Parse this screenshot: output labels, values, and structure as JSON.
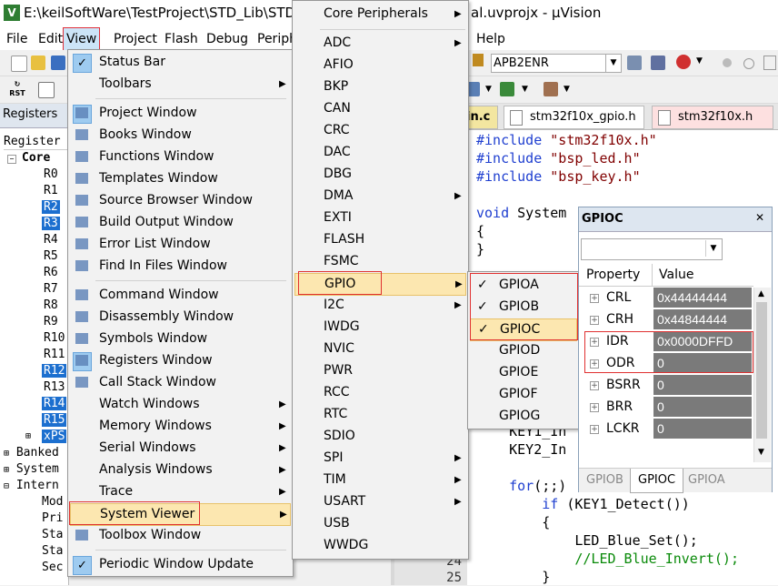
{
  "title_bar": {
    "app_icon": "keil-logo-icon",
    "text": "E:\\keilSoftWare\\TestProject\\STD_Lib\\STD",
    "text_right": "al.uvprojx - µVision"
  },
  "menubar": {
    "items": [
      "File",
      "Edit",
      "View",
      "Project",
      "Flash",
      "Debug",
      "Periph",
      "Help"
    ],
    "selected": "View"
  },
  "toolbar": {
    "target_combo": "APB2ENR"
  },
  "registers_panel": {
    "tab": "Registers",
    "header": "Register",
    "core_label": "Core",
    "rows": [
      "R0",
      "R1",
      "R2",
      "R3",
      "R4",
      "R5",
      "R6",
      "R7",
      "R8",
      "R9",
      "R10",
      "R11",
      "R12",
      "R13",
      "R14",
      "R15",
      "xPS"
    ],
    "highlighted": [
      "R2",
      "R3",
      "R12",
      "R14",
      "R15",
      "xPS"
    ],
    "groups": [
      "Banked",
      "System",
      "Intern"
    ],
    "sub_items": [
      "Mod",
      "Pri",
      "Sta",
      "Sta",
      "Sec"
    ]
  },
  "editor": {
    "tabs": [
      {
        "label": "in.c",
        "color": "#f3e6a0"
      },
      {
        "label": "stm32f10x_gpio.h",
        "color": "#fff"
      },
      {
        "label": "stm32f10x.h",
        "color": "#fde0e0"
      }
    ],
    "lines": [
      {
        "parts": [
          {
            "t": "#include ",
            "c": "kw"
          },
          {
            "t": "\"stm32f10x.h\"",
            "c": "str"
          }
        ]
      },
      {
        "parts": [
          {
            "t": "#include ",
            "c": "kw"
          },
          {
            "t": "\"bsp_led.h\"",
            "c": "str"
          }
        ]
      },
      {
        "parts": [
          {
            "t": "#include ",
            "c": "kw"
          },
          {
            "t": "\"bsp_key.h\"",
            "c": "str"
          }
        ]
      },
      {
        "parts": [
          {
            "t": "",
            "c": ""
          }
        ]
      },
      {
        "parts": [
          {
            "t": "void ",
            "c": "kw"
          },
          {
            "t": "System",
            "c": ""
          }
        ]
      },
      {
        "parts": [
          {
            "t": "{",
            "c": ""
          }
        ]
      },
      {
        "parts": [
          {
            "t": "}",
            "c": ""
          }
        ]
      }
    ],
    "lower_lines": [
      {
        "parts": [
          {
            "t": "    KEY1_In",
            "c": ""
          }
        ]
      },
      {
        "parts": [
          {
            "t": "    KEY2_In",
            "c": ""
          }
        ]
      },
      {
        "parts": [
          {
            "t": "",
            "c": ""
          }
        ]
      },
      {
        "parts": [
          {
            "t": "    ",
            "c": ""
          },
          {
            "t": "for",
            "c": "kw"
          },
          {
            "t": "(;;)",
            "c": ""
          }
        ]
      },
      {
        "parts": [
          {
            "t": "        ",
            "c": ""
          },
          {
            "t": "if",
            "c": "kw"
          },
          {
            "t": " (KEY1_Detect())",
            "c": ""
          }
        ]
      },
      {
        "parts": [
          {
            "t": "        {",
            "c": ""
          }
        ]
      },
      {
        "parts": [
          {
            "t": "            LED_Blue_Set();",
            "c": ""
          }
        ]
      },
      {
        "parts": [
          {
            "t": "            ",
            "c": ""
          },
          {
            "t": "//LED_Blue_Invert();",
            "c": "com"
          }
        ]
      },
      {
        "parts": [
          {
            "t": "        }",
            "c": ""
          }
        ]
      }
    ],
    "line_numbers": [
      "24",
      "25"
    ]
  },
  "view_menu": {
    "items": [
      {
        "label": "Status Bar",
        "icon": "check",
        "arrow": false
      },
      {
        "label": "Toolbars",
        "icon": "",
        "arrow": true
      },
      {
        "sep": true
      },
      {
        "label": "Project Window",
        "icon": "project-window-icon",
        "arrow": false,
        "checked": true
      },
      {
        "label": "Books Window",
        "icon": "books-icon",
        "arrow": false
      },
      {
        "label": "Functions Window",
        "icon": "functions-icon",
        "arrow": false
      },
      {
        "label": "Templates Window",
        "icon": "templates-icon",
        "arrow": false
      },
      {
        "label": "Source Browser Window",
        "icon": "source-browser-icon",
        "arrow": false
      },
      {
        "label": "Build Output Window",
        "icon": "build-output-icon",
        "arrow": false
      },
      {
        "label": "Error List Window",
        "icon": "error-list-icon",
        "arrow": false
      },
      {
        "label": "Find In Files Window",
        "icon": "find-in-files-icon",
        "arrow": false
      },
      {
        "sep": true
      },
      {
        "label": "Command Window",
        "icon": "command-window-icon",
        "arrow": false
      },
      {
        "label": "Disassembly Window",
        "icon": "disassembly-icon",
        "arrow": false
      },
      {
        "label": "Symbols Window",
        "icon": "symbols-icon",
        "arrow": false
      },
      {
        "label": "Registers Window",
        "icon": "registers-icon",
        "arrow": false,
        "checked": true
      },
      {
        "label": "Call Stack Window",
        "icon": "call-stack-icon",
        "arrow": false
      },
      {
        "label": "Watch Windows",
        "icon": "",
        "arrow": true
      },
      {
        "label": "Memory Windows",
        "icon": "",
        "arrow": true
      },
      {
        "label": "Serial Windows",
        "icon": "",
        "arrow": true
      },
      {
        "label": "Analysis Windows",
        "icon": "",
        "arrow": true
      },
      {
        "label": "Trace",
        "icon": "",
        "arrow": true
      },
      {
        "label": "System Viewer",
        "icon": "",
        "arrow": true,
        "hover": true
      },
      {
        "label": "Toolbox Window",
        "icon": "toolbox-icon",
        "arrow": false
      },
      {
        "sep": true
      },
      {
        "label": "Periodic Window Update",
        "icon": "check",
        "arrow": false
      }
    ]
  },
  "system_viewer_menu": {
    "items": [
      {
        "label": "Core Peripherals",
        "arrow": true
      },
      {
        "sep": true
      },
      {
        "label": "ADC",
        "arrow": true
      },
      {
        "label": "AFIO",
        "arrow": false
      },
      {
        "label": "BKP",
        "arrow": false
      },
      {
        "label": "CAN",
        "arrow": false
      },
      {
        "label": "CRC",
        "arrow": false
      },
      {
        "label": "DAC",
        "arrow": false
      },
      {
        "label": "DBG",
        "arrow": false
      },
      {
        "label": "DMA",
        "arrow": true
      },
      {
        "label": "EXTI",
        "arrow": false
      },
      {
        "label": "FLASH",
        "arrow": false
      },
      {
        "label": "FSMC",
        "arrow": false
      },
      {
        "label": "GPIO",
        "arrow": true,
        "hover": true
      },
      {
        "label": "I2C",
        "arrow": true
      },
      {
        "label": "IWDG",
        "arrow": false
      },
      {
        "label": "NVIC",
        "arrow": false
      },
      {
        "label": "PWR",
        "arrow": false
      },
      {
        "label": "RCC",
        "arrow": false
      },
      {
        "label": "RTC",
        "arrow": false
      },
      {
        "label": "SDIO",
        "arrow": false
      },
      {
        "label": "SPI",
        "arrow": true
      },
      {
        "label": "TIM",
        "arrow": true
      },
      {
        "label": "USART",
        "arrow": true
      },
      {
        "label": "USB",
        "arrow": false
      },
      {
        "label": "WWDG",
        "arrow": false
      }
    ]
  },
  "gpio_menu": {
    "items": [
      {
        "label": "GPIOA",
        "checked": true
      },
      {
        "label": "GPIOB",
        "checked": true
      },
      {
        "label": "GPIOC",
        "checked": true,
        "hover": true
      },
      {
        "label": "GPIOD",
        "checked": false
      },
      {
        "label": "GPIOE",
        "checked": false
      },
      {
        "label": "GPIOF",
        "checked": false
      },
      {
        "label": "GPIOG",
        "checked": false
      }
    ]
  },
  "gpioc_window": {
    "title": "GPIOC",
    "close_icon": "close-icon",
    "columns": [
      "Property",
      "Value"
    ],
    "rows": [
      {
        "name": "CRL",
        "value": "0x44444444"
      },
      {
        "name": "CRH",
        "value": "0x44844444"
      },
      {
        "name": "IDR",
        "value": "0x0000DFFD"
      },
      {
        "name": "ODR",
        "value": "0"
      },
      {
        "name": "BSRR",
        "value": "0"
      },
      {
        "name": "BRR",
        "value": "0"
      },
      {
        "name": "LCKR",
        "value": "0"
      }
    ],
    "tabs": [
      "GPIOB",
      "GPIOC",
      "GPIOA"
    ],
    "active_tab": "GPIOC"
  }
}
